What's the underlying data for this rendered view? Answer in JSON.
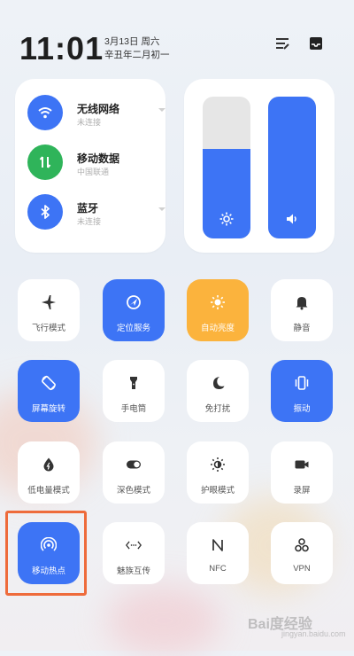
{
  "status": {
    "time": "11:01",
    "date_line1": "3月13日 周六",
    "date_line2": "辛丑年二月初一"
  },
  "header_icons": [
    "edit-list-icon",
    "inbox-icon"
  ],
  "connectivity": [
    {
      "title": "无线网络",
      "subtitle": "未连接",
      "icon": "wifi-icon",
      "color": "#3d74f5"
    },
    {
      "title": "移动数据",
      "subtitle": "中国联通",
      "icon": "mobile-data-icon",
      "color": "#2fb45a"
    },
    {
      "title": "蓝牙",
      "subtitle": "未连接",
      "icon": "bluetooth-icon",
      "color": "#3d74f5"
    }
  ],
  "sliders": {
    "brightness": {
      "level": 0.63,
      "icon": "brightness-icon"
    },
    "volume": {
      "level": 1.0,
      "icon": "volume-icon"
    }
  },
  "tiles": [
    {
      "label": "飞行模式",
      "icon": "airplane-icon",
      "state": "off"
    },
    {
      "label": "定位服务",
      "icon": "location-icon",
      "state": "on"
    },
    {
      "label": "自动亮度",
      "icon": "auto-brightness-icon",
      "state": "on-orange"
    },
    {
      "label": "静音",
      "icon": "bell-icon",
      "state": "off"
    },
    {
      "label": "屏幕旋转",
      "icon": "rotate-icon",
      "state": "on"
    },
    {
      "label": "手电筒",
      "icon": "flashlight-icon",
      "state": "off"
    },
    {
      "label": "免打扰",
      "icon": "moon-icon",
      "state": "off"
    },
    {
      "label": "振动",
      "icon": "vibrate-icon",
      "state": "on"
    },
    {
      "label": "低电量模式",
      "icon": "battery-saver-icon",
      "state": "off"
    },
    {
      "label": "深色模式",
      "icon": "dark-mode-icon",
      "state": "off"
    },
    {
      "label": "护眼模式",
      "icon": "eye-care-icon",
      "state": "off"
    },
    {
      "label": "录屏",
      "icon": "screen-record-icon",
      "state": "off"
    },
    {
      "label": "移动热点",
      "icon": "hotspot-icon",
      "state": "on"
    },
    {
      "label": "魅族互传",
      "icon": "share-icon",
      "state": "off"
    },
    {
      "label": "NFC",
      "icon": "nfc-icon",
      "state": "off"
    },
    {
      "label": "VPN",
      "icon": "vpn-icon",
      "state": "off"
    }
  ],
  "colors": {
    "accent": "#3d74f5",
    "green": "#2fb45a",
    "orange": "#fbb33d",
    "highlight": "#ee6b3b"
  },
  "watermark": {
    "text": "Bai度经验",
    "sub": "jingyan.baidu.com"
  }
}
